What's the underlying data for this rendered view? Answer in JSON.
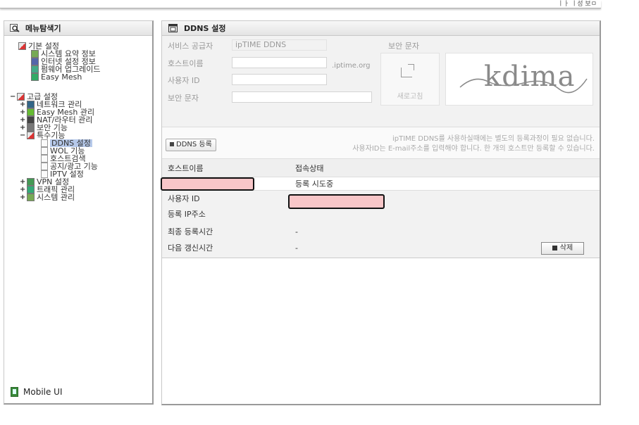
{
  "top": {
    "link": "ㅣㅏ ㅣ성 보ㅁ"
  },
  "left": {
    "title": "메뉴탐색기",
    "basic": {
      "label": "기본 설정",
      "items": [
        "시스템 요약 정보",
        "인터넷 설정 정보",
        "펌웨어 업그레이드",
        "Easy Mesh"
      ]
    },
    "advanced": {
      "label": "고급 설정",
      "items": [
        "네트워크 관리",
        "Easy Mesh 관리",
        "NAT/라우터 관리",
        "보안 기능",
        "특수기능"
      ]
    },
    "special": {
      "items": [
        "DDNS 설정",
        "WOL 기능",
        "호스트검색",
        "공지/광고 기능",
        "IPTV 설정"
      ]
    },
    "more": [
      "VPN 설정",
      "트래픽 관리",
      "시스템 관리"
    ],
    "mobile": "Mobile UI"
  },
  "right": {
    "title": "DDNS 설정",
    "form": {
      "provider_label": "서비스 공급자",
      "provider_value": "ipTIME DDNS",
      "host_label": "호스트이름",
      "domain_suffix": ".iptime.org",
      "user_label": "사용자 ID",
      "captcha_input_label": "보안 문자",
      "captcha_label": "보안 문자",
      "refresh_label": "새로고침",
      "captcha_text": "kdima"
    },
    "register_button": "DDNS 등록",
    "notice": [
      "ipTIME DDNS를 사용하실때에는 별도의 등록과정이 필요 없습니다.",
      "사용자ID는 E-mail주소를 입력해야 합니다. 한 개의 호스트만 등록할 수 있습니다."
    ],
    "table": {
      "col_host": "호스트이름",
      "col_status": "접속상태",
      "status_value": "등록 시도중"
    },
    "detail": {
      "user_label": "사용자 ID",
      "ip_label": "등록 IP주소",
      "ip_value": "",
      "last_label": "최종 등록시간",
      "last_value": "-",
      "next_label": "다음 갱신시간",
      "next_value": "-",
      "delete_label": "삭제"
    }
  }
}
